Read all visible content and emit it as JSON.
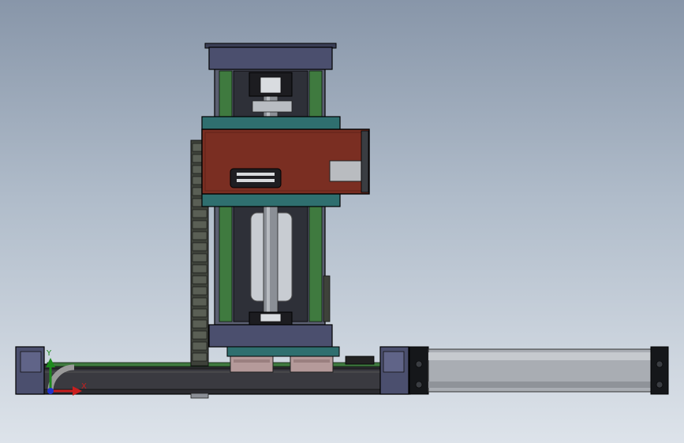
{
  "view": {
    "background_top": "#8896a9",
    "background_bottom": "#dde3ea"
  },
  "triad": {
    "y_label": "Y",
    "x_label": "X",
    "y_color": "#1d8a1d",
    "x_color": "#c81e1e",
    "origin_color": "#2233cc"
  },
  "model": {
    "frame_color": "#4b4f6e",
    "carriage_plate_color": "#7a2e22",
    "mounting_plate_color": "#2f6f6f",
    "rail_color": "#3f7a3f",
    "screw_color": "#8b8f96",
    "cylinder_color": "#a9adb3"
  }
}
